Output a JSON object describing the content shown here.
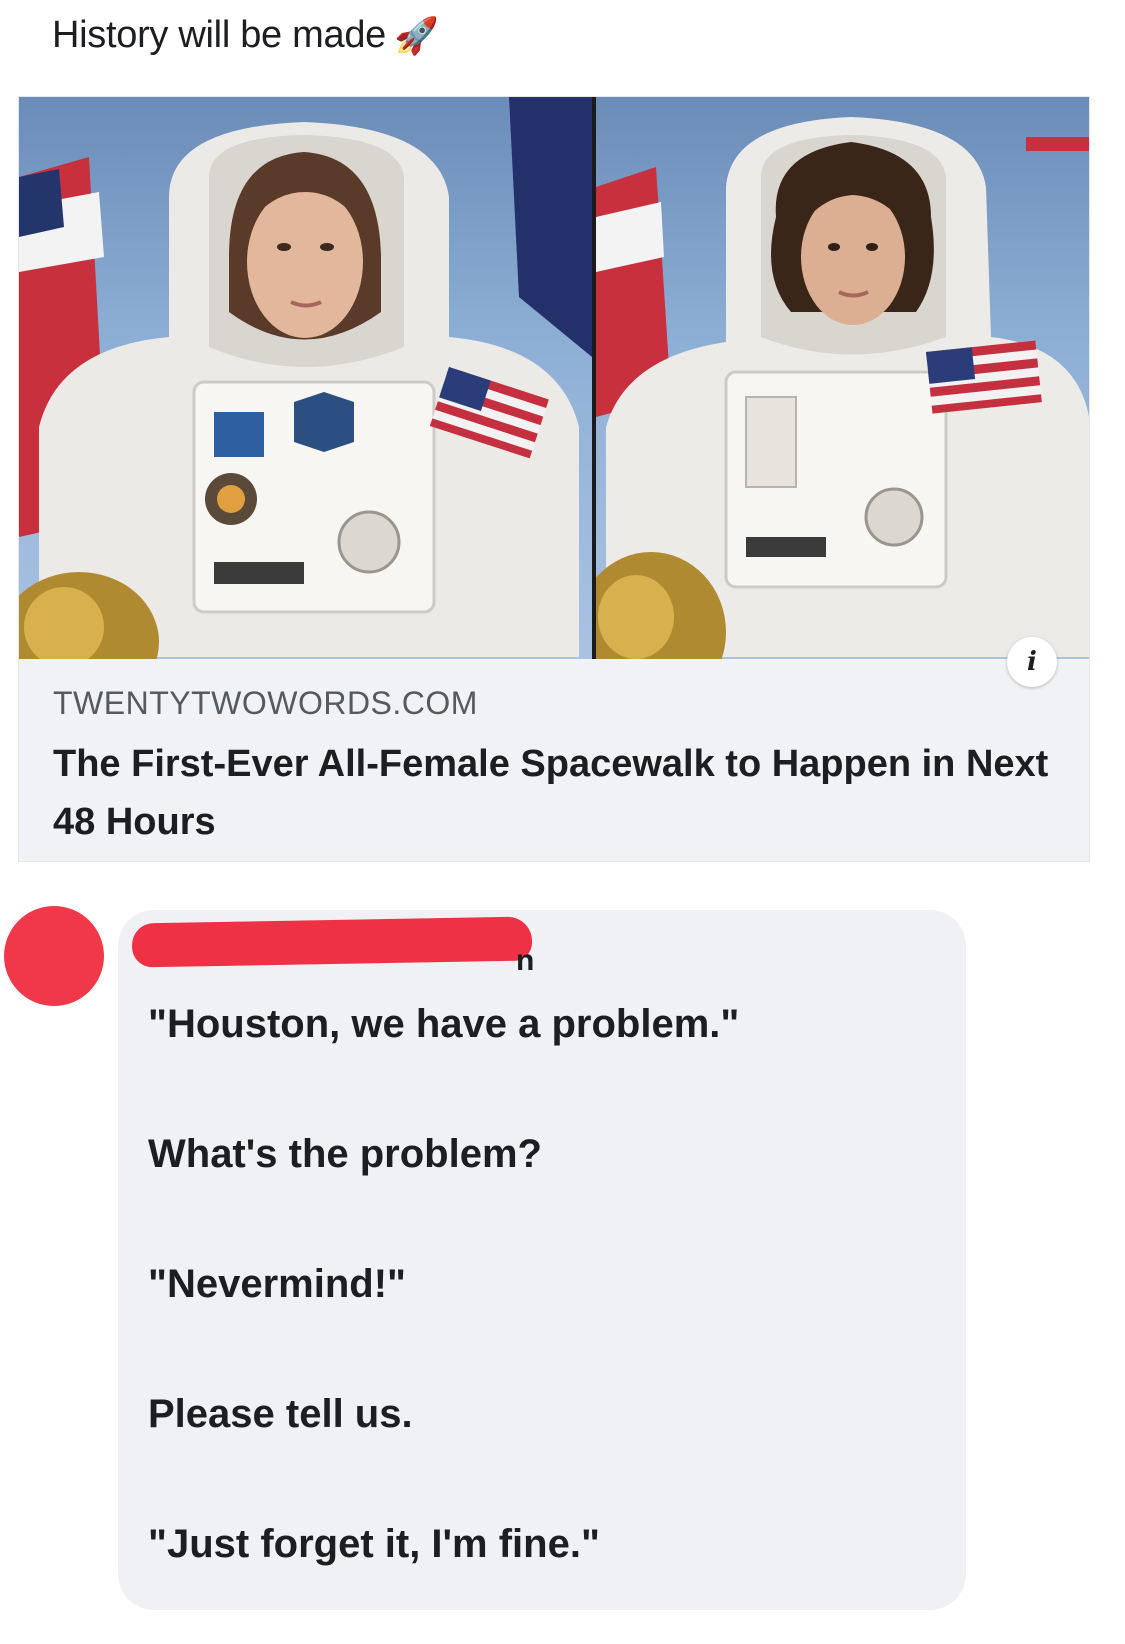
{
  "post": {
    "text": "History will be made",
    "emoji": "🚀"
  },
  "link_card": {
    "domain": "TWENTYTWOWORDS.COM",
    "headline": "The First-Ever All-Female Spacewalk to Happen in Next 48 Hours",
    "info_icon": "i"
  },
  "comment": {
    "author_name_visible_fragment": "n",
    "lines": [
      "\"Houston, we have a problem.\"",
      "What's the problem?",
      "\"Nevermind!\"",
      "Please tell us.",
      "\"Just forget it, I'm fine.\""
    ]
  },
  "colors": {
    "redaction": "#ef3145",
    "card_bg": "#f0f2f5",
    "bubble_bg": "#f0f1f4"
  }
}
